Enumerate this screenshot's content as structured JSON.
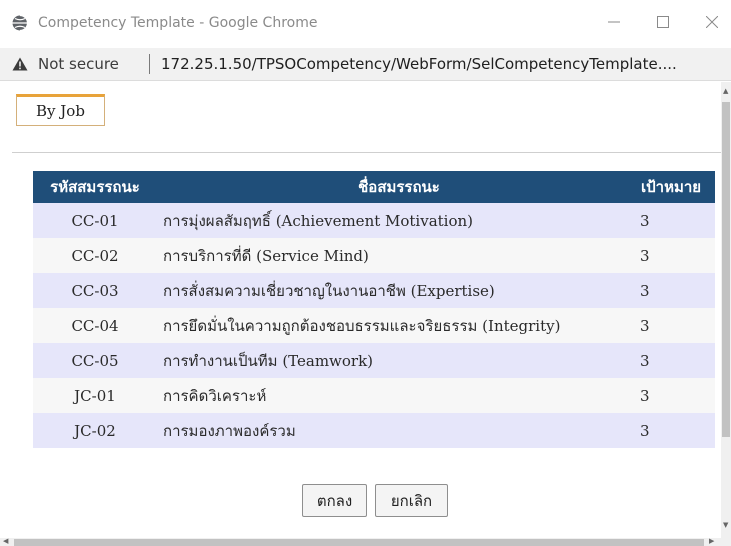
{
  "window": {
    "title": "Competency Template - Google Chrome"
  },
  "address": {
    "security_label": "Not secure",
    "url": "172.25.1.50/TPSOCompetency/WebForm/SelCompetencyTemplate...."
  },
  "tab": {
    "label": "By Job"
  },
  "table": {
    "headers": {
      "code": "รหัสสมรรถนะ",
      "name": "ชื่อสมรรถนะ",
      "target": "เป้าหมาย"
    },
    "rows": [
      {
        "code": "CC-01",
        "name": "การมุ่งผลสัมฤทธิ์ (Achievement Motivation)",
        "target": "3"
      },
      {
        "code": "CC-02",
        "name": "การบริการที่ดี (Service Mind)",
        "target": "3"
      },
      {
        "code": "CC-03",
        "name": "การสั่งสมความเชี่ยวชาญในงานอาชีพ (Expertise)",
        "target": "3"
      },
      {
        "code": "CC-04",
        "name": "การยึดมั่นในความถูกต้องชอบธรรมและจริยธรรม (Integrity)",
        "target": "3"
      },
      {
        "code": "CC-05",
        "name": "การทำงานเป็นทีม (Teamwork)",
        "target": "3"
      },
      {
        "code": "JC-01",
        "name": "การคิดวิเคราะห์",
        "target": "3"
      },
      {
        "code": "JC-02",
        "name": "การมองภาพองค์รวม",
        "target": "3"
      }
    ]
  },
  "buttons": {
    "ok": "ตกลง",
    "cancel": "ยกเลิก"
  },
  "colors": {
    "header_bg": "#1f4e79",
    "row_odd": "#e6e6fa",
    "row_even": "#f7f7f7",
    "tab_accent": "#e8a33a"
  },
  "icons": {
    "browser": "globe-icon",
    "security": "warning-icon",
    "minimize": "minimize-icon",
    "maximize": "maximize-icon",
    "close": "close-icon"
  }
}
